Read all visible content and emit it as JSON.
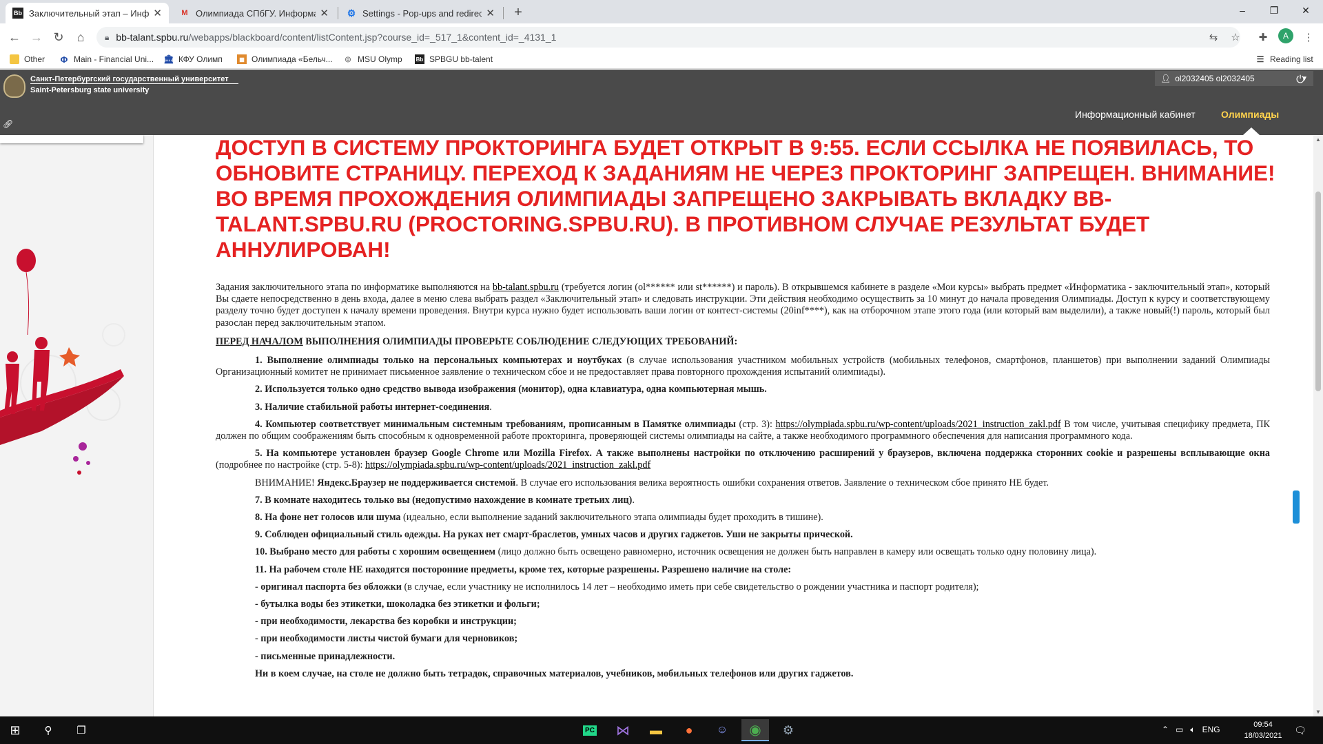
{
  "browser": {
    "tabs": [
      {
        "label": "Заключительный этап – Инфор",
        "icon": "Bb",
        "active": true
      },
      {
        "label": "Олимпиада СПбГУ. Информати",
        "icon": "M",
        "active": false
      },
      {
        "label": "Settings - Pop-ups and redirects",
        "icon": "⚙",
        "active": false
      }
    ],
    "new_tab": "+",
    "window_controls": [
      "–",
      "❐",
      "✕"
    ],
    "url_host": "bb-talant.spbu.ru",
    "url_path": "/webapps/blackboard/content/listContent.jsp?course_id=_517_1&content_id=_4131_1",
    "avatar_letter": "A",
    "bookmarks": [
      {
        "label": "Other",
        "icon": "folder-icon"
      },
      {
        "label": "Main - Financial Uni...",
        "icon": "globe-icon"
      },
      {
        "label": "КФУ Олимп",
        "icon": "building-icon"
      },
      {
        "label": "Олимпиада «Бельч...",
        "icon": "grid-icon"
      },
      {
        "label": "MSU Olymp",
        "icon": "circle-icon"
      },
      {
        "label": "SPBGU bb-talent",
        "icon": "bb-icon"
      }
    ],
    "reading_list": "Reading list"
  },
  "site": {
    "university_ru": "Санкт-Петербургский государственный университет",
    "university_en": "Saint-Petersburg state university",
    "user": "ol2032405 ol2032405",
    "nav": [
      "Информационный кабинет",
      "Олимпиады"
    ]
  },
  "content": {
    "alert": "ДОСТУП В СИСТЕМУ ПРОКТОРИНГА БУДЕТ ОТКРЫТ В 9:55. ЕСЛИ ССЫЛКА НЕ ПОЯВИЛАСЬ, ТО ОБНОВИТЕ СТРАНИЦУ. ПЕРЕХОД К ЗАДАНИЯМ НЕ ЧЕРЕЗ ПРОКТОРИНГ ЗАПРЕЩЕН. ВНИМАНИЕ! ВО ВРЕМЯ ПРОХОЖДЕНИЯ ОЛИМПИАДЫ ЗАПРЕЩЕНО ЗАКРЫВАТЬ  ВКЛАДКУ BB-TALANT.SPBU.RU (PROCTORING.SPBU.RU). В ПРОТИВНОМ СЛУЧАЕ РЕЗУЛЬТАТ БУДЕТ АННУЛИРОВАН!",
    "intro_a": "Задания заключительного этапа по информатике выполняются на ",
    "intro_link": "bb-talant.spbu.ru",
    "intro_b": " (требуется логин (ol****** или st******) и пароль). В открывшемся кабинете в разделе «Мои курсы» выбрать предмет «Информатика - заключительный этап», который Вы сдаете непосредственно в день входа, далее в меню слева выбрать раздел «Заключительный этап» и следовать инструкции. Эти действия необходимо осуществить за 10 минут до начала проведения Олимпиады. Доступ к курсу и соответствующему разделу точно будет доступен к началу времени проведения. Внутри курса нужно будет использовать ваши логин от контест-системы (20inf****), как на отборочном этапе этого года (или который вам выделили), а также новый(!) пароль, который был разослан перед заключительным этапом.",
    "heading_underlined": "ПЕРЕД НАЧАЛОМ",
    "heading_rest": " ВЫПОЛНЕНИЯ ОЛИМПИАДЫ ПРОВЕРЬТЕ СОБЛЮДЕНИЕ СЛЕДУЮЩИХ ТРЕБОВАНИЙ:",
    "r1_bold": "1. Выполнение олимпиады только на персональных компьютерах и ноутбуках",
    "r1_rest": " (в случае использования участником мобильных устройств (мобильных телефонов, смартфонов, планшетов) при выполнении заданий Олимпиады Организационный комитет не принимает письменное заявление о техническом сбое и не предоставляет права повторного прохождения испытаний олимпиады).",
    "r2_bold": "2. Используется только одно средство вывода изображения (монитор), одна клавиатура, одна компьютерная мышь.",
    "r3_bold": "3. Наличие стабильной работы интернет-соединения",
    "r3_rest": ".",
    "r4_bold": "4. Компьютер соответствует минимальным системным требованиям, прописанным в Памятке олимпиады",
    "r4_mid": " (стр. 3): ",
    "r4_link": "https://olympiada.spbu.ru/wp-content/uploads/2021_instruction_zakl.pdf",
    "r4_rest": "  В том числе, учитывая специфику предмета, ПК должен по общим соображениям быть способным к одновременной работе прокторинга, проверяющей системы олимпиады на сайте, а также необходимого программного обеспечения для написания программного кода.",
    "r5_bold": "5. На компьютере установлен браузер Google Chrome или Mozilla Firefox. А также выполнены настройки по отключению расширений у браузеров, включена поддержка сторонних cookie и разрешены всплывающие окна",
    "r5_mid": " (подробнее по настройке (стр. 5-8): ",
    "r5_link": "https://olympiada.spbu.ru/wp-content/uploads/2021_instruction_zakl.pdf",
    "warn_a": "ВНИМАНИЕ! ",
    "warn_bold": "Яндекс.Браузер не поддерживается системой",
    "warn_rest": ". В случае его использования велика вероятность ошибки сохранения ответов. Заявление о техническом сбое принято НЕ будет.",
    "r7_bold": "7. В комнате находитесь только вы (недопустимо нахождение в комнате третьих лиц)",
    "r7_rest": ".",
    "r8_bold": "8. На фоне нет голосов или шума",
    "r8_rest": " (идеально, если выполнение заданий заключительного этапа олимпиады будет проходить в тишине).",
    "r9_bold": "9. Соблюден официальный стиль одежды. На руках нет смарт-браслетов, умных часов и других гаджетов. Уши не закрыты прической.",
    "r10_bold": "10. Выбрано место для работы с хорошим освещением",
    "r10_rest": " (лицо должно быть освещено равномерно, источник освещения не должен быть направлен в камеру или освещать только одну половину лица).",
    "r11_bold": "11. На рабочем столе НЕ находятся посторонние предметы, кроме тех, которые разрешены. Разрешено наличие на столе:",
    "d1_bold": "- оригинал паспорта без обложки",
    "d1_rest": " (в случае, если участнику не исполнилось 14 лет – необходимо иметь при себе свидетельство о рождении участника и паспорт родителя);",
    "d2_bold": "- бутылка воды без этикетки, шоколадка без этикетки и фольги;",
    "d3_bold": "- при необходимости, лекарства без коробки и инструкции;",
    "d4_bold": "- при необходимости листы чистой бумаги для черновиков;",
    "d5_bold": "- письменные принадлежности.",
    "final_bold": "Ни в коем случае, на столе не должно быть тетрадок, справочных материалов, учебников, мобильных телефонов или других гаджетов."
  },
  "taskbar": {
    "apps": [
      "start-icon",
      "search-icon",
      "task-view-icon",
      "pycharm-icon",
      "visual-studio-icon",
      "explorer-icon",
      "firefox-icon",
      "discord-icon",
      "chrome-icon",
      "steam-icon"
    ],
    "lang": "ENG",
    "time": "09:54",
    "date": "18/03/2021"
  }
}
